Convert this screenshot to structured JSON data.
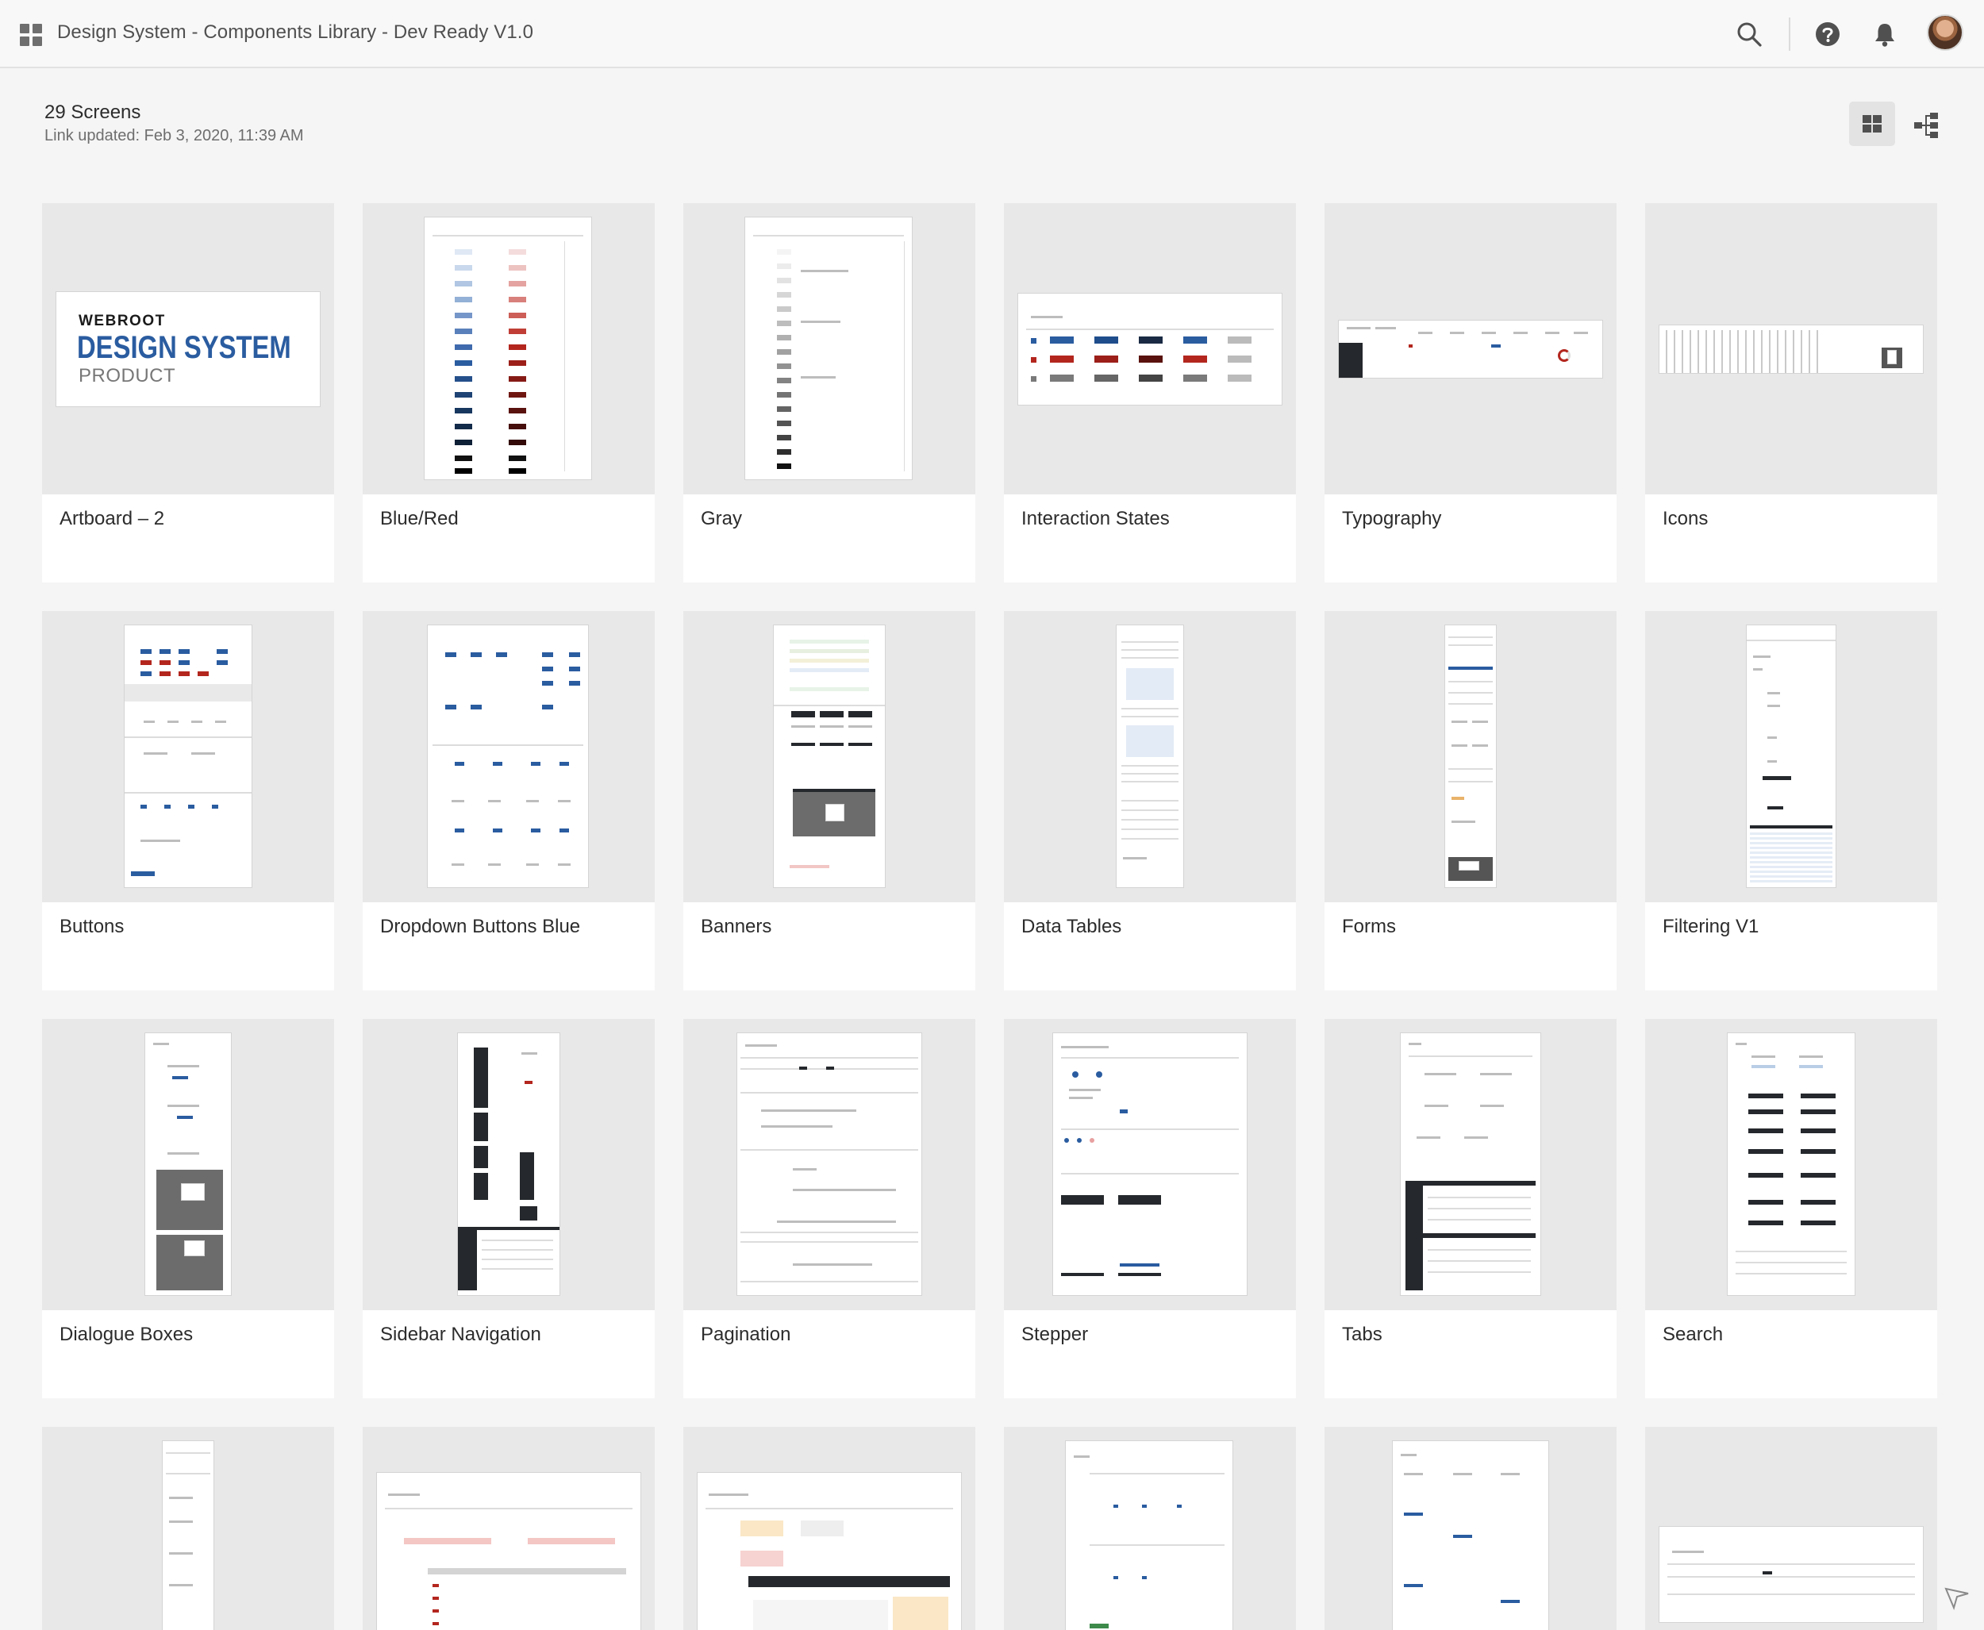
{
  "app": {
    "title": "Design System - Components Library - Dev Ready V1.0",
    "icons": {
      "apps": "apps-grid-icon",
      "search": "search-icon",
      "help": "help-icon",
      "notifications": "bell-icon",
      "avatar": "user-avatar"
    }
  },
  "header": {
    "count": "29 Screens",
    "updated": "Link updated: Feb 3, 2020, 11:39 AM",
    "views": [
      "grid-view-icon",
      "flow-view-icon"
    ]
  },
  "cover": {
    "brand": "WEBROOT",
    "heading": "DESIGN SYSTEM",
    "sub": "PRODUCT"
  },
  "screens": [
    {
      "label": "Artboard – 2"
    },
    {
      "label": "Blue/Red"
    },
    {
      "label": "Gray"
    },
    {
      "label": "Interaction States"
    },
    {
      "label": "Typography"
    },
    {
      "label": "Icons"
    },
    {
      "label": "Buttons"
    },
    {
      "label": "Dropdown Buttons Blue"
    },
    {
      "label": "Banners"
    },
    {
      "label": "Data Tables"
    },
    {
      "label": "Forms"
    },
    {
      "label": "Filtering V1"
    },
    {
      "label": "Dialogue Boxes"
    },
    {
      "label": "Sidebar Navigation"
    },
    {
      "label": "Pagination"
    },
    {
      "label": "Stepper"
    },
    {
      "label": "Tabs"
    },
    {
      "label": "Search"
    }
  ],
  "colors": {
    "brand_blue": "#2a5ca0",
    "brand_red": "#b3261e",
    "background": "#f5f5f5",
    "card": "#ffffff",
    "thumb": "#e8e8e8"
  }
}
